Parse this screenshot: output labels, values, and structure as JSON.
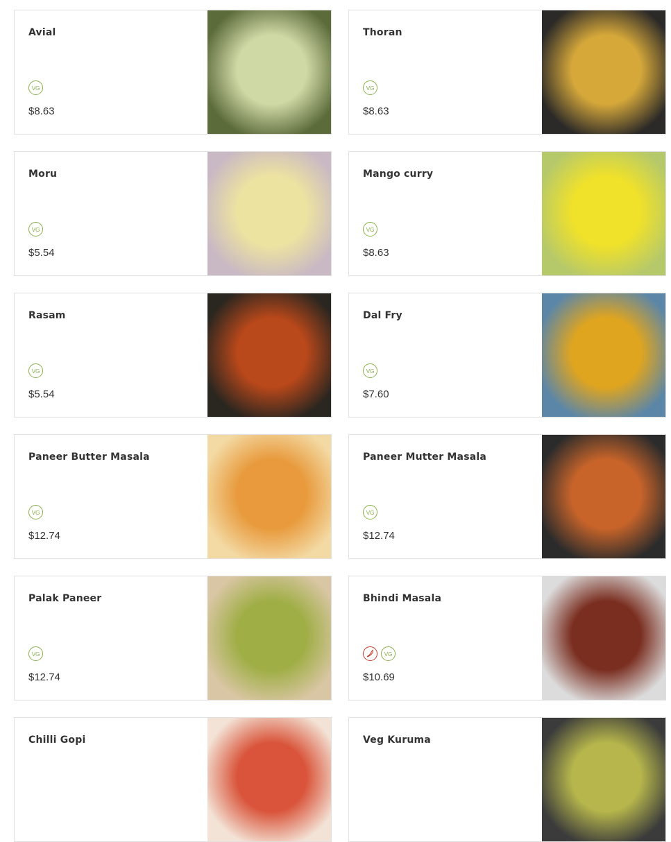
{
  "menu": {
    "items": [
      {
        "name": "",
        "tags": [],
        "price": "",
        "colors": [
          "#6b2e1f",
          "#3a2a1a"
        ]
      },
      {
        "name": "",
        "tags": [],
        "price": "",
        "colors": [
          "#5a3d2a",
          "#2a2220"
        ]
      },
      {
        "name": "Avial",
        "tags": [
          "vg"
        ],
        "price": "$8.63",
        "colors": [
          "#cfd9a6",
          "#5c6b3a"
        ]
      },
      {
        "name": "Thoran",
        "tags": [
          "vg"
        ],
        "price": "$8.63",
        "colors": [
          "#d6a83a",
          "#2c2a28"
        ]
      },
      {
        "name": "Moru",
        "tags": [
          "vg"
        ],
        "price": "$5.54",
        "colors": [
          "#ede3a0",
          "#c9b9c4"
        ]
      },
      {
        "name": "Mango curry",
        "tags": [
          "vg"
        ],
        "price": "$8.63",
        "colors": [
          "#f0e12a",
          "#b6c96a"
        ]
      },
      {
        "name": "Rasam",
        "tags": [
          "vg"
        ],
        "price": "$5.54",
        "colors": [
          "#b9481a",
          "#2a2620"
        ]
      },
      {
        "name": "Dal Fry",
        "tags": [
          "vg"
        ],
        "price": "$7.60",
        "colors": [
          "#e0a51e",
          "#5b86a8"
        ]
      },
      {
        "name": "Paneer Butter Masala",
        "tags": [
          "vg"
        ],
        "price": "$12.74",
        "colors": [
          "#e89a3c",
          "#f3d9a3"
        ]
      },
      {
        "name": "Paneer Mutter Masala",
        "tags": [
          "vg"
        ],
        "price": "$12.74",
        "colors": [
          "#c8642a",
          "#2b2b2b"
        ]
      },
      {
        "name": "Palak Paneer",
        "tags": [
          "vg"
        ],
        "price": "$12.74",
        "colors": [
          "#9fae45",
          "#d9c6a4"
        ]
      },
      {
        "name": "Bhindi Masala",
        "tags": [
          "spicy",
          "vg"
        ],
        "price": "$10.69",
        "colors": [
          "#7a2e20",
          "#dcdcdc"
        ]
      },
      {
        "name": "Chilli Gopi",
        "tags": [],
        "price": "",
        "colors": [
          "#d9543a",
          "#f3e3d6"
        ]
      },
      {
        "name": "Veg Kuruma",
        "tags": [],
        "price": "",
        "colors": [
          "#b6b64c",
          "#3b3b3b"
        ]
      }
    ]
  },
  "badges": {
    "vg": "VG"
  },
  "icons": {
    "vg": "vegetarian-icon",
    "spicy": "chili-pepper-icon"
  }
}
